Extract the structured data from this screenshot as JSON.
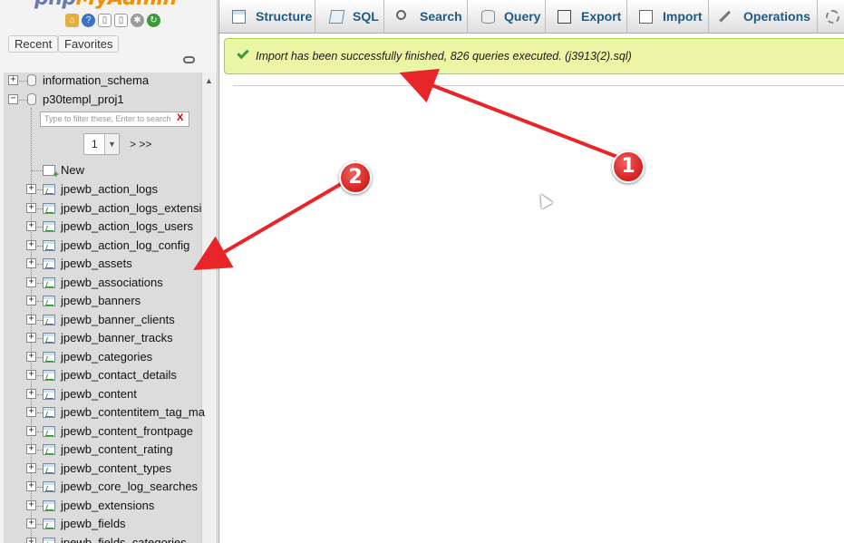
{
  "nav": {
    "logo_part1": "php",
    "logo_part2": "MyAdmin",
    "quick_icons": [
      "home-icon",
      "help-icon",
      "docs-icon",
      "docs2-icon",
      "settings-icon",
      "reload-icon"
    ],
    "tab_recent": "Recent",
    "tab_favorites": "Favorites",
    "databases": [
      {
        "name": "information_schema",
        "expander": "+"
      },
      {
        "name": "p30templ_proj1",
        "expander": "−"
      }
    ],
    "filter_placeholder": "Type to filter these, Enter to search",
    "filter_clear": "X",
    "pager_value": "1",
    "pager_next": "> >>",
    "new_label": "New",
    "tables": [
      "jpewb_action_logs",
      "jpewb_action_logs_extensi",
      "jpewb_action_logs_users",
      "jpewb_action_log_config",
      "jpewb_assets",
      "jpewb_associations",
      "jpewb_banners",
      "jpewb_banner_clients",
      "jpewb_banner_tracks",
      "jpewb_categories",
      "jpewb_contact_details",
      "jpewb_content",
      "jpewb_contentitem_tag_ma",
      "jpewb_content_frontpage",
      "jpewb_content_rating",
      "jpewb_content_types",
      "jpewb_core_log_searches",
      "jpewb_extensions",
      "jpewb_fields",
      "jpewb_fields_categories"
    ]
  },
  "tabs": [
    {
      "label": "Structure",
      "icon": "structure-icon"
    },
    {
      "label": "SQL",
      "icon": "sql-icon"
    },
    {
      "label": "Search",
      "icon": "search-icon"
    },
    {
      "label": "Query",
      "icon": "query-icon"
    },
    {
      "label": "Export",
      "icon": "export-icon"
    },
    {
      "label": "Import",
      "icon": "import-icon"
    },
    {
      "label": "Operations",
      "icon": "operations-icon"
    },
    {
      "label": "",
      "icon": "more-icon"
    }
  ],
  "notice": {
    "text": "Import has been successfully finished, 826 queries executed. (j3913(2).sql)"
  },
  "annotations": {
    "badge_1": "1",
    "badge_2": "2",
    "color": "#e8262a"
  },
  "colors": {
    "tab_text": "#235a81",
    "notice_bg": "#ebf5a6",
    "notice_border": "#a2d246"
  }
}
